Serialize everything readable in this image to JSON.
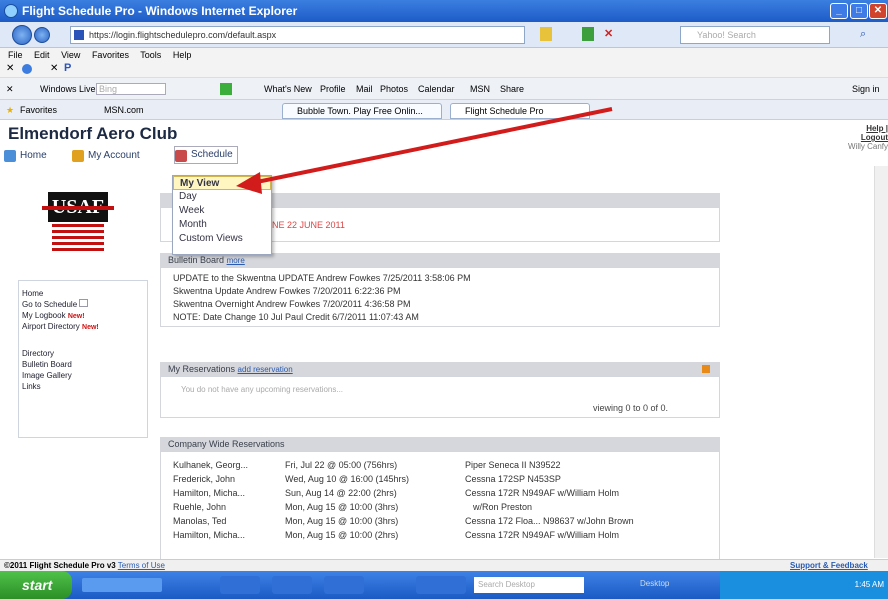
{
  "window": {
    "title": "Flight Schedule Pro - Windows Internet Explorer"
  },
  "browser": {
    "address": "https://login.flightschedulepro.com/default.aspx",
    "search_placeholder": "Yahoo! Search",
    "menu": [
      "File",
      "Edit",
      "View",
      "Favorites",
      "Tools",
      "Help"
    ],
    "toolbar2": [
      "Windows Live",
      "Bing",
      "What's New",
      "Profile",
      "Mail",
      "Photos",
      "Calendar",
      "MSN",
      "Share"
    ],
    "toolbar2_right": "Sign in",
    "favorites_label": "Favorites",
    "fav_links": [
      "MSN.com"
    ],
    "tabs": [
      "Bubble Town. Play Free Onlin...",
      "Flight Schedule Pro"
    ]
  },
  "page": {
    "club_name": "Elmendorf Aero Club",
    "help_login": "Help | Logout",
    "user_name": "Willy Canfy",
    "nav": [
      "Home",
      "My Account",
      "Schedule"
    ],
    "schedule_menu": [
      "My View",
      "Day",
      "Week",
      "Month",
      "Custom Views"
    ],
    "logo_text": "USAF",
    "sidebar": {
      "items": [
        "Home",
        "Go to Schedule",
        "My Logbook",
        "Airport Directory",
        "Directory",
        "Bulletin Board",
        "Image Gallery",
        "Links"
      ],
      "new_badge": "New!"
    },
    "announce_date": "JUNE 22 JUNE 2011",
    "bulletin": {
      "header": "Bulletin Board",
      "more": "more",
      "posts": [
        "UPDATE to the Skwentna UPDATE Andrew Fowkes 7/25/2011 3:58:06 PM",
        "Skwentna Update Andrew Fowkes 7/20/2011 6:22:36 PM",
        "Skwentna Overnight Andrew Fowkes 7/20/2011 4:36:58 PM",
        "NOTE: Date Change 10 Jul Paul Credit 6/7/2011 11:07:43 AM"
      ]
    },
    "reservations": {
      "header": "My Reservations",
      "add_link": "add reservation",
      "empty": "You do not have any upcoming reservations...",
      "viewing": "viewing 0 to 0 of 0."
    },
    "company": {
      "header": "Company Wide Reservations",
      "rows": [
        {
          "name": "Kulhanek, Georg...",
          "when": "Fri, Jul 22 @ 05:00 (756hrs)",
          "aircraft": "Piper Seneca II N39522"
        },
        {
          "name": "Frederick, John",
          "when": "Wed, Aug 10 @ 16:00 (145hrs)",
          "aircraft": "Cessna 172SP N453SP"
        },
        {
          "name": "Hamilton, Micha...",
          "when": "Sun, Aug 14 @ 22:00 (2hrs)",
          "aircraft": "Cessna 172R N949AF w/William Holm"
        },
        {
          "name": "Ruehle, John",
          "when": "Mon, Aug 15 @ 10:00 (3hrs)",
          "aircraft": "w/Ron Preston"
        },
        {
          "name": "Manolas, Ted",
          "when": "Mon, Aug 15 @ 10:00 (3hrs)",
          "aircraft": "Cessna 172 Floa... N98637 w/John Brown"
        },
        {
          "name": "Hamilton, Micha...",
          "when": "Mon, Aug 15 @ 10:00 (2hrs)",
          "aircraft": "Cessna 172R N949AF w/William Holm"
        }
      ]
    },
    "footer_left": "©2011 Flight Schedule Pro v3",
    "footer_terms": "Terms of Use",
    "footer_right": "Support & Feedback"
  },
  "taskbar": {
    "start": "start",
    "search": "Search Desktop",
    "desktop": "Desktop",
    "time": "1:45 AM"
  },
  "colors": {
    "arrow": "#d21c1c",
    "selected_bg": "#fff6c2",
    "taskbar": "#1d5bc7"
  }
}
